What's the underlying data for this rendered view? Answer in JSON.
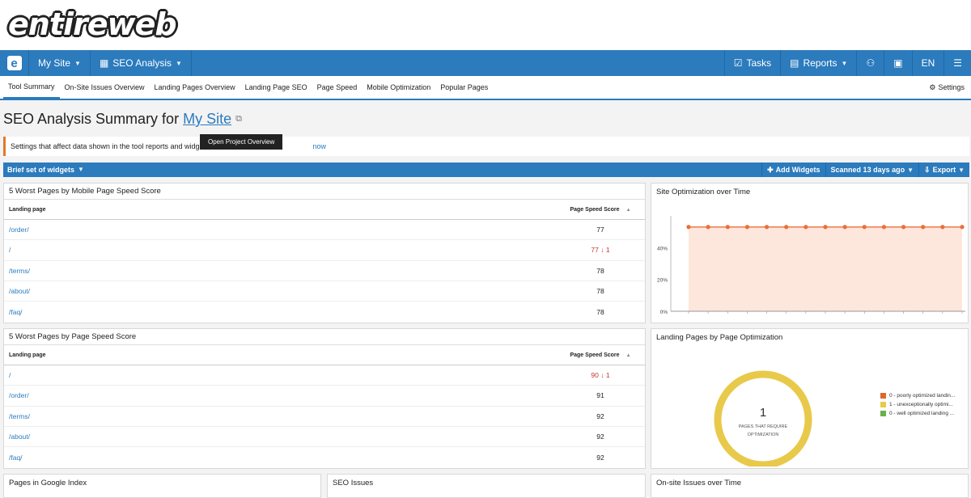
{
  "brand": {
    "logo_text": "entireweb"
  },
  "topnav": {
    "e_logo": "e",
    "site": "My Site",
    "module": "SEO Analysis",
    "tasks": "Tasks",
    "reports": "Reports",
    "lang": "EN"
  },
  "subnav": {
    "tabs": [
      "Tool Summary",
      "On-Site Issues Overview",
      "Landing Pages Overview",
      "Landing Page SEO",
      "Page Speed",
      "Mobile Optimization",
      "Popular Pages"
    ],
    "settings": "Settings"
  },
  "page": {
    "title_prefix": "SEO Analysis Summary for",
    "title_link": "My Site"
  },
  "notice": {
    "text": "Settings that affect data shown in the tool reports and widgets",
    "link": "now"
  },
  "tooltip": "Open Project Overview",
  "widgetbar": {
    "set": "Brief set of widgets",
    "add": "Add Widgets",
    "scanned": "Scanned 13 days ago",
    "export": "Export"
  },
  "mobile_speed": {
    "title": "5 Worst Pages by Mobile Page Speed Score",
    "col1": "Landing page",
    "col2": "Page Speed Score",
    "rows": [
      {
        "page": "/order/",
        "score": "77",
        "delta": ""
      },
      {
        "page": "/",
        "score": "77",
        "delta": "1"
      },
      {
        "page": "/terms/",
        "score": "78",
        "delta": ""
      },
      {
        "page": "/about/",
        "score": "78",
        "delta": ""
      },
      {
        "page": "/faq/",
        "score": "78",
        "delta": ""
      }
    ]
  },
  "page_speed": {
    "title": "5 Worst Pages by Page Speed Score",
    "col1": "Landing page",
    "col2": "Page Speed Score",
    "rows": [
      {
        "page": "/",
        "score": "90",
        "delta": "1"
      },
      {
        "page": "/order/",
        "score": "91",
        "delta": ""
      },
      {
        "page": "/terms/",
        "score": "92",
        "delta": ""
      },
      {
        "page": "/about/",
        "score": "92",
        "delta": ""
      },
      {
        "page": "/faq/",
        "score": "92",
        "delta": ""
      }
    ]
  },
  "site_opt": {
    "title": "Site Optimization over Time"
  },
  "landing_opt": {
    "title": "Landing Pages by Page Optimization",
    "count": "1",
    "label1": "PAGES THAT REQUIRE",
    "label2": "OPTIMIZATION",
    "legend": [
      "0 - poorly optimized landin...",
      "1 - unexceptionally optimi...",
      "0 - well optimized landing ..."
    ],
    "legend_colors": [
      "#e0662a",
      "#e8c94a",
      "#6ab04c"
    ]
  },
  "bottom": {
    "index": "Pages in Google Index",
    "issues": "SEO Issues",
    "onsite": "On-site Issues over Time"
  },
  "colors": {
    "accent": "#2b7bbd",
    "line": "#e8703a",
    "area": "#fde6dc"
  },
  "chart_data": [
    {
      "type": "area",
      "title": "Site Optimization over Time",
      "y": [
        53,
        53,
        53,
        53,
        53,
        53,
        53,
        53,
        53,
        53,
        53,
        53,
        53,
        53,
        53
      ],
      "ylim": [
        0,
        60
      ],
      "yticks": [
        "0%",
        "20%",
        "40%"
      ],
      "grid": false
    },
    {
      "type": "pie",
      "title": "Landing Pages by Page Optimization",
      "categories": [
        "0 - poorly optimized landin...",
        "1 - unexceptionally optimi...",
        "0 - well optimized landing ..."
      ],
      "values": [
        0,
        1,
        0
      ]
    }
  ]
}
